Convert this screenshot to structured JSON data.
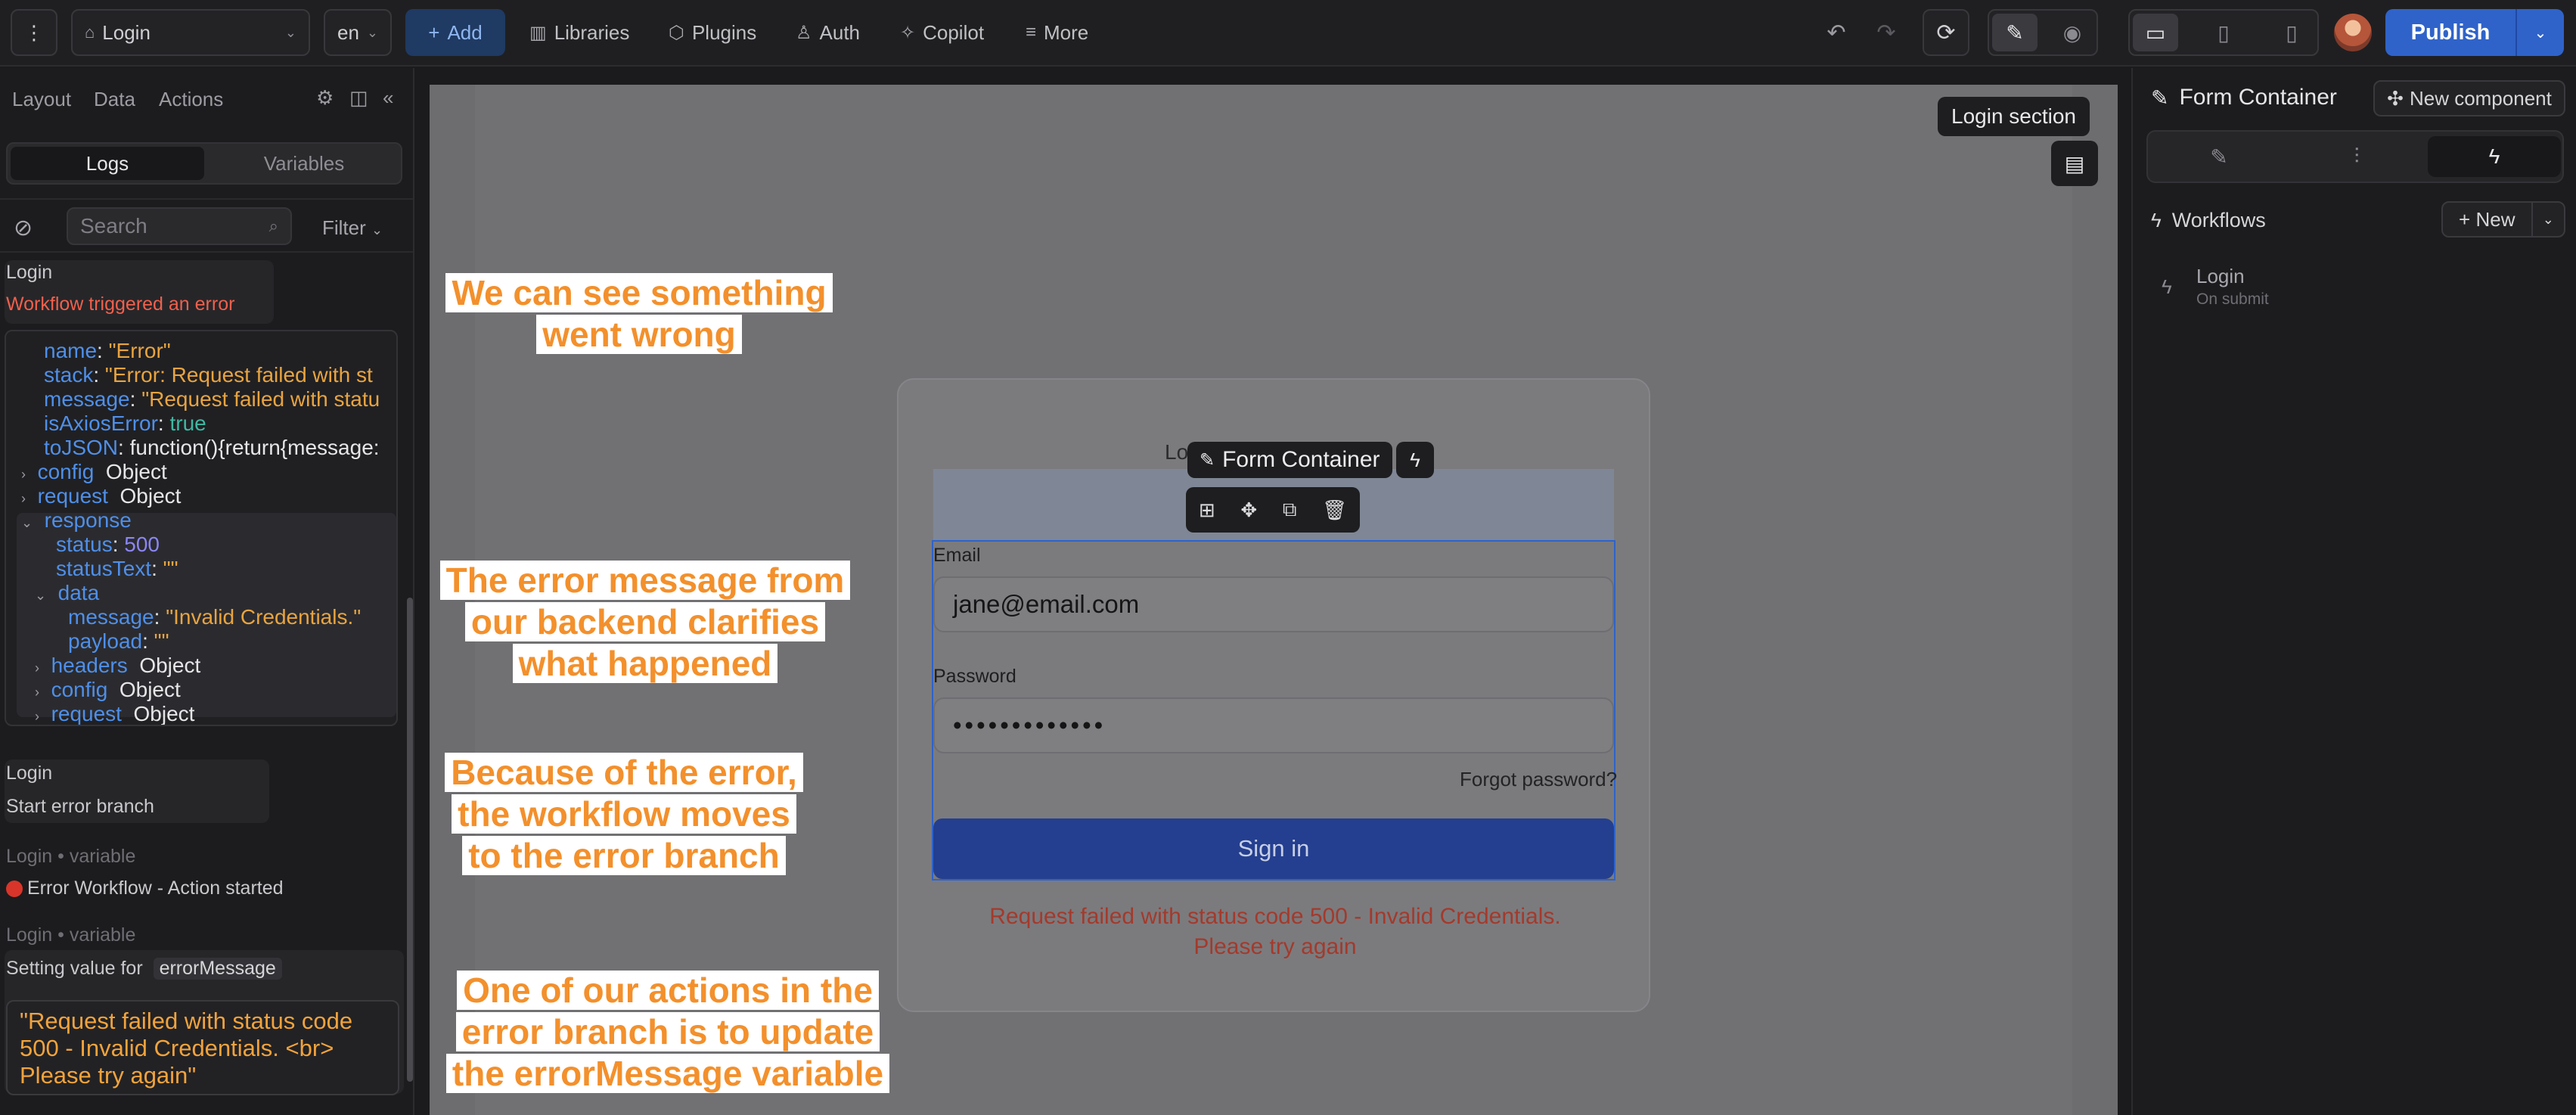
{
  "topbar": {
    "page_select": "Login",
    "lang_select": "en",
    "add_label": "Add",
    "nav": [
      "Libraries",
      "Plugins",
      "Auth",
      "Copilot",
      "More"
    ],
    "publish_label": "Publish"
  },
  "left": {
    "tabs": [
      "Layout",
      "Data",
      "Actions"
    ],
    "toggle": [
      "Logs",
      "Variables"
    ],
    "search_placeholder": "Search",
    "filter_label": "Filter",
    "log1": {
      "title": "Login",
      "error": "Workflow triggered an error"
    },
    "code": {
      "name_k": "name",
      "name_v": "\"Error\"",
      "stack_k": "stack",
      "stack_v": "\"Error: Request failed with st",
      "message_k": "message",
      "message_v": "\"Request failed with statu",
      "axios_k": "isAxiosError",
      "axios_v": "true",
      "tojson_k": "toJSON",
      "tojson_v": "function(){return{message:",
      "config_k": "config",
      "request_k": "request",
      "object_v": "Object",
      "response_k": "response",
      "status_k": "status",
      "status_v": "500",
      "statustext_k": "statusText",
      "statustext_v": "\"\"",
      "data_k": "data",
      "dmsg_k": "message",
      "dmsg_v": "\"Invalid Credentials.\"",
      "payload_k": "payload",
      "payload_v": "\"\"",
      "headers_k": "headers"
    },
    "log2": {
      "title": "Login",
      "text": "Start error branch"
    },
    "log3": {
      "title": "Login • variable",
      "text": "Error Workflow - Action started"
    },
    "log4": {
      "title": "Login • variable",
      "prefix": "Setting value for",
      "chip": "errorMessage"
    },
    "value": "\"Request failed with status code 500 - Invalid Credentials. <br> Please try again\""
  },
  "canvas": {
    "section_tag": "Login section",
    "lo_title": "Lo",
    "component_tag": "Form Container",
    "email_label": "Email",
    "email_value": "jane@email.com",
    "password_label": "Password",
    "password_value": "•••••••••••••",
    "forgot": "Forgot password?",
    "signin": "Sign in",
    "error_line1": "Request failed with status code 500 - Invalid Credentials.",
    "error_line2": "Please try again"
  },
  "annotations": {
    "a1_l1": "We can see something",
    "a1_l2": "went wrong",
    "a2_l1": "The error message from",
    "a2_l2": "our backend clarifies",
    "a2_l3": "what happened",
    "a3_l1": "Because of the error,",
    "a3_l2": "the workflow moves",
    "a3_l3": "to the error branch",
    "a4_l1": "One of our actions in the",
    "a4_l2": "error branch is to update",
    "a4_l3": "the errorMessage variable"
  },
  "right": {
    "title": "Form Container",
    "new_component": "New component",
    "workflows_label": "Workflows",
    "new_label": "New",
    "wf_item": "Login",
    "wf_sub": "On submit"
  }
}
